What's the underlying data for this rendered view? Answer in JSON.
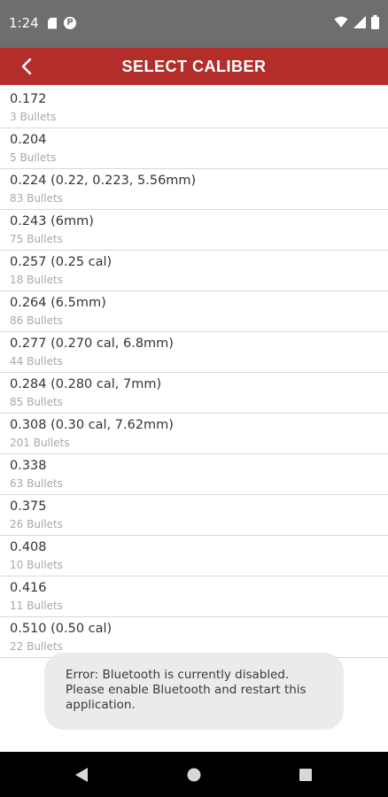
{
  "status_bar": {
    "time": "1:24",
    "left_icons": [
      "sim-card-icon",
      "p-icon"
    ],
    "right_icons": [
      "wifi-icon",
      "signal-icon",
      "battery-icon"
    ]
  },
  "app_bar": {
    "title": "SELECT CALIBER",
    "back_icon": "chevron-left-icon",
    "color": "#b32e2a"
  },
  "calibers": [
    {
      "name": "0.172",
      "count": "3 Bullets"
    },
    {
      "name": "0.204",
      "count": "5 Bullets"
    },
    {
      "name": "0.224 (0.22, 0.223, 5.56mm)",
      "count": "83 Bullets"
    },
    {
      "name": "0.243 (6mm)",
      "count": "75 Bullets"
    },
    {
      "name": "0.257 (0.25 cal)",
      "count": "18 Bullets"
    },
    {
      "name": "0.264 (6.5mm)",
      "count": "86 Bullets"
    },
    {
      "name": "0.277 (0.270 cal, 6.8mm)",
      "count": "44 Bullets"
    },
    {
      "name": "0.284 (0.280 cal, 7mm)",
      "count": "85 Bullets"
    },
    {
      "name": "0.308 (0.30 cal, 7.62mm)",
      "count": "201 Bullets"
    },
    {
      "name": "0.338",
      "count": "63 Bullets"
    },
    {
      "name": "0.375",
      "count": "26 Bullets"
    },
    {
      "name": "0.408",
      "count": "10 Bullets"
    },
    {
      "name": "0.416",
      "count": "11 Bullets"
    },
    {
      "name": "0.510 (0.50 cal)",
      "count": "22 Bullets"
    }
  ],
  "toast": {
    "lines": [
      "Error: Bluetooth is currently disabled.",
      "Please enable Bluetooth and restart this",
      "application."
    ]
  },
  "nav_bar": {
    "icons": [
      "back-triangle-icon",
      "home-circle-icon",
      "recents-square-icon"
    ]
  }
}
